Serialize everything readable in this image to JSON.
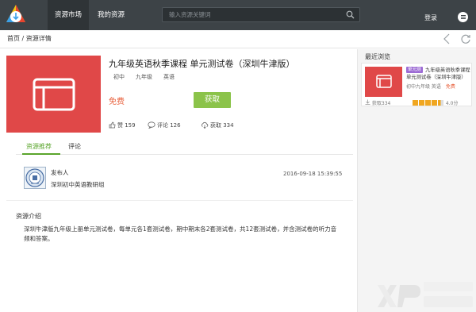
{
  "topbar": {
    "tabs": [
      {
        "label": "资源市场",
        "active": true
      },
      {
        "label": "我的资源",
        "active": false
      }
    ],
    "search_placeholder": "输入资源关键词",
    "login_label": "登录"
  },
  "breadcrumb": {
    "home": "首页",
    "separator": " / ",
    "current": "资源详情"
  },
  "resource": {
    "title": "九年级英语秋季课程 单元测试卷（深圳牛津版）",
    "tags": [
      "初中",
      "九年级",
      "英语"
    ],
    "price": "免费",
    "get_button": "获取",
    "likes_label": "赞 159",
    "comments_label": "评论 126",
    "downloads_label": "获取 334"
  },
  "tabs": {
    "recommend": "资源推荐",
    "comment": "评论"
  },
  "publisher": {
    "label": "发布人",
    "name": "深圳初中英语教研组",
    "date": "2016-09-18 15:39:55"
  },
  "intro": {
    "title": "资源介绍",
    "text": "深圳牛津版九年级上册单元测试卷，每单元各1套测试卷，期中期末各2套测试卷，共12套测试卷，并含测试卷的听力音频和答案。"
  },
  "sidebar": {
    "title": "最近浏览",
    "card": {
      "badge": "单元测",
      "title": "九年级英语秋季课程 单元测试卷（深圳牛津版）",
      "meta": "初中九年级 英语",
      "price": "免费",
      "get_count": "获取334",
      "rating": "4.0分"
    }
  },
  "colors": {
    "topbar": "#3d4347",
    "accent_green": "#8bc34a",
    "cover_red": "#e04848",
    "price_orange": "#e8603c"
  }
}
